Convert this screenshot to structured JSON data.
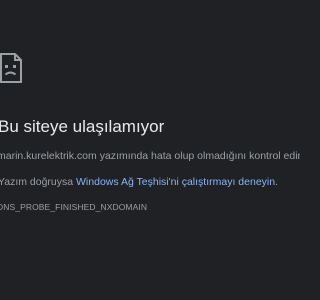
{
  "error": {
    "icon": "sad-page-icon",
    "title": "Bu siteye ulaşılamıyor",
    "description": "marin.kurelektrik.com yazımında hata olup olmadığını kontrol edin.",
    "suggestion_prefix": "Yazım doğruysa ",
    "suggestion_link": "Windows Ağ Teşhisi'ni çalıştırmayı deneyin",
    "suggestion_suffix": ".",
    "code": "DNS_PROBE_FINISHED_NXDOMAIN"
  },
  "colors": {
    "background": "#202124",
    "title": "#e8eaed",
    "text": "#9aa0a6",
    "link": "#8ab4f8"
  }
}
